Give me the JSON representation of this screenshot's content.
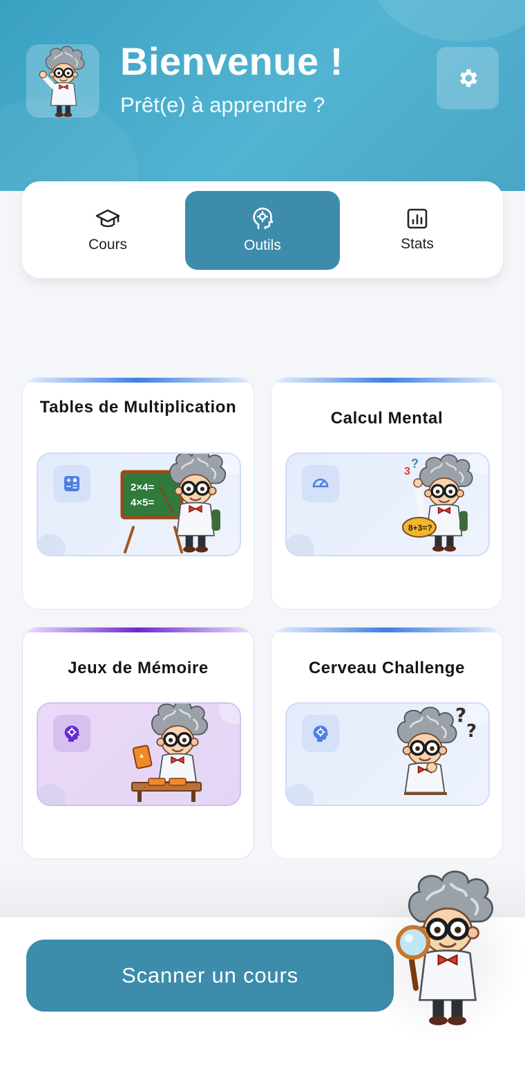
{
  "header": {
    "title": "Bienvenue !",
    "subtitle": "Prêt(e) à apprendre ?",
    "avatar_icon": "professor-waving-icon",
    "settings_icon": "gear-icon"
  },
  "tabs": [
    {
      "label": "Cours",
      "icon": "graduation-cap-icon",
      "active": false
    },
    {
      "label": "Outils",
      "icon": "head-gear-icon",
      "active": true
    },
    {
      "label": "Stats",
      "icon": "bar-chart-icon",
      "active": false
    }
  ],
  "cards": [
    {
      "title": "Tables de Multiplication",
      "icon": "calculator-icon",
      "illustration": "professor-blackboard-icon",
      "board_text": [
        "2×4=",
        "4×5="
      ],
      "accent": "#3f7fe0"
    },
    {
      "title": "Calcul Mental",
      "icon": "speedometer-icon",
      "illustration": "professor-thinking-math-icon",
      "bubble_text": "8+3=?",
      "accent": "#3f7fe0"
    },
    {
      "title": "Jeux de Mémoire",
      "icon": "brain-gear-icon",
      "illustration": "professor-cards-icon",
      "accent": "#6a2ad0"
    },
    {
      "title": "Cerveau Challenge",
      "icon": "brain-gear-icon",
      "illustration": "professor-puzzled-icon",
      "accent": "#3f7fe0"
    }
  ],
  "bottom": {
    "scan_label": "Scanner un cours",
    "mascot_icon": "professor-magnifier-icon"
  },
  "colors": {
    "header": "#4aa8c8",
    "primary_button": "#3d8cac",
    "accent_blue": "#3f7fe0",
    "accent_purple": "#6a2ad0"
  }
}
